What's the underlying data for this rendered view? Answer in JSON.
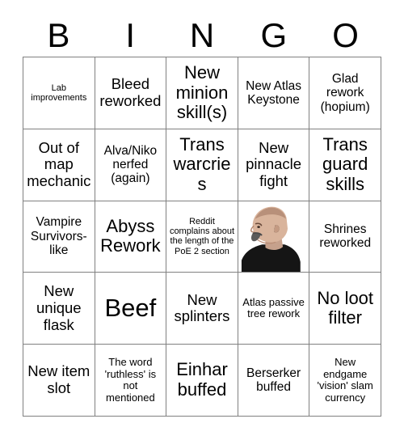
{
  "card": {
    "headers": [
      "B",
      "I",
      "N",
      "G",
      "O"
    ],
    "rows": [
      [
        {
          "text": "Lab improvements",
          "size": "s-xs",
          "type": "text"
        },
        {
          "text": "Bleed reworked",
          "size": "s-lg",
          "type": "text"
        },
        {
          "text": "New minion skill(s)",
          "size": "s-xl",
          "type": "text"
        },
        {
          "text": "New Atlas Keystone",
          "size": "s-md",
          "type": "text"
        },
        {
          "text": "Glad rework (hopium)",
          "size": "s-md",
          "type": "text"
        }
      ],
      [
        {
          "text": "Out of map mechanic",
          "size": "s-lg",
          "type": "text"
        },
        {
          "text": "Alva/Niko nerfed (again)",
          "size": "s-md",
          "type": "text"
        },
        {
          "text": "Trans warcries",
          "size": "s-xl",
          "type": "text"
        },
        {
          "text": "New pinnacle fight",
          "size": "s-lg",
          "type": "text"
        },
        {
          "text": "Trans guard skills",
          "size": "s-xl",
          "type": "text"
        }
      ],
      [
        {
          "text": "Vampire Survivors-like",
          "size": "s-md",
          "type": "text"
        },
        {
          "text": "Abyss Rework",
          "size": "s-xl",
          "type": "text"
        },
        {
          "text": "Reddit complains about the length of the PoE 2 section",
          "size": "s-xs",
          "type": "text"
        },
        {
          "text": "",
          "size": "s-sm",
          "type": "image",
          "image_alt": "photo of a bald man with a goatee wearing a black shirt, facing left"
        },
        {
          "text": "Shrines reworked",
          "size": "s-md",
          "type": "text"
        }
      ],
      [
        {
          "text": "New unique flask",
          "size": "s-lg",
          "type": "text"
        },
        {
          "text": "Beef",
          "size": "s-xxl",
          "type": "text"
        },
        {
          "text": "New splinters",
          "size": "s-lg",
          "type": "text"
        },
        {
          "text": "Atlas passive tree rework",
          "size": "s-sm",
          "type": "text"
        },
        {
          "text": "No loot filter",
          "size": "s-xl",
          "type": "text"
        }
      ],
      [
        {
          "text": "New item slot",
          "size": "s-lg",
          "type": "text"
        },
        {
          "text": "The word 'ruthless' is not mentioned",
          "size": "s-sm",
          "type": "text"
        },
        {
          "text": "Einhar buffed",
          "size": "s-xl",
          "type": "text"
        },
        {
          "text": "Berserker buffed",
          "size": "s-md",
          "type": "text"
        },
        {
          "text": "New endgame 'vision' slam currency",
          "size": "s-sm",
          "type": "text"
        }
      ]
    ]
  },
  "colors": {
    "background": "#ffffff",
    "text": "#000000",
    "grid_line": "#808080"
  }
}
